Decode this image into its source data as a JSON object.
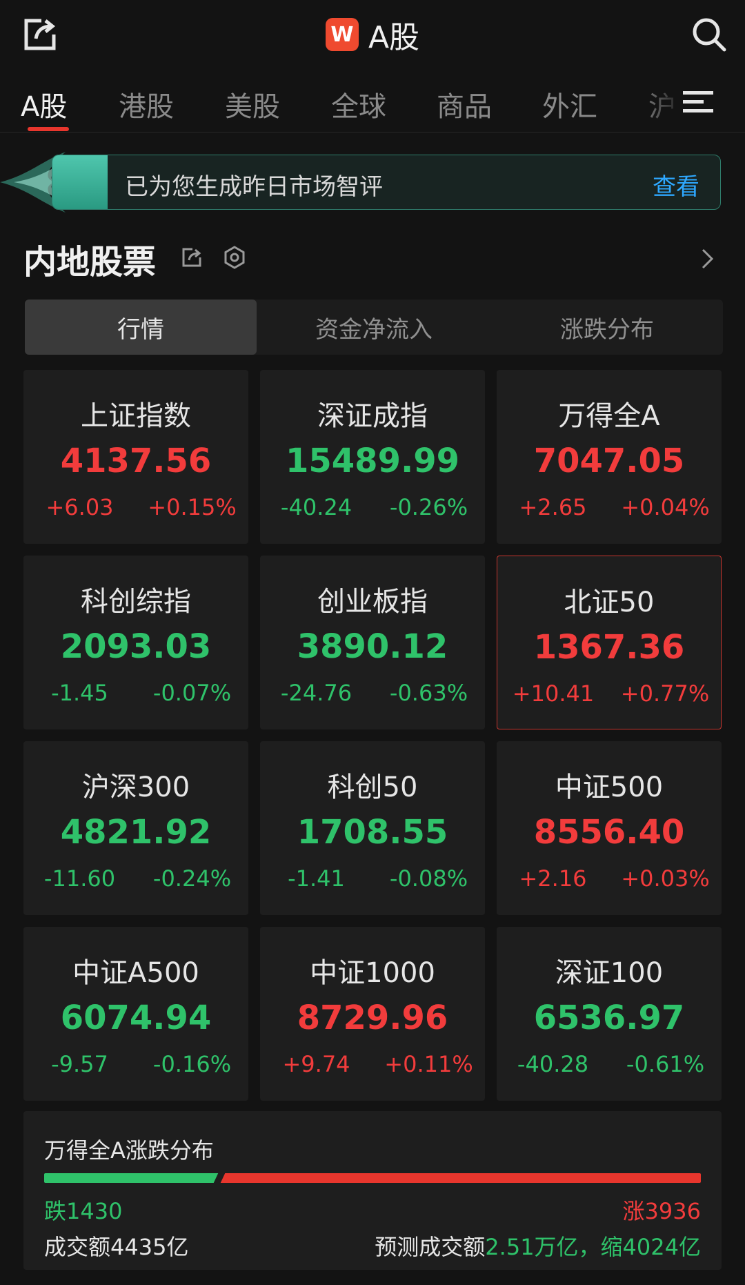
{
  "header": {
    "title": "A股",
    "logo_text": "W",
    "logo_color": "#ef4a2f"
  },
  "tabs": [
    {
      "label": "A股",
      "active": true
    },
    {
      "label": "港股",
      "active": false
    },
    {
      "label": "美股",
      "active": false
    },
    {
      "label": "全球",
      "active": false
    },
    {
      "label": "商品",
      "active": false
    },
    {
      "label": "外汇",
      "active": false
    },
    {
      "label": "沪",
      "active": false
    }
  ],
  "banner": {
    "text": "已为您生成昨日市场智评",
    "link": "查看"
  },
  "section": {
    "title": "内地股票"
  },
  "segments": [
    {
      "label": "行情",
      "active": true
    },
    {
      "label": "资金净流入",
      "active": false
    },
    {
      "label": "涨跌分布",
      "active": false
    }
  ],
  "indices": [
    {
      "name": "上证指数",
      "value": "4137.56",
      "change": "+6.03",
      "pct": "+0.15%",
      "dir": "up"
    },
    {
      "name": "深证成指",
      "value": "15489.99",
      "change": "-40.24",
      "pct": "-0.26%",
      "dir": "down"
    },
    {
      "name": "万得全A",
      "value": "7047.05",
      "change": "+2.65",
      "pct": "+0.04%",
      "dir": "up"
    },
    {
      "name": "科创综指",
      "value": "2093.03",
      "change": "-1.45",
      "pct": "-0.07%",
      "dir": "down"
    },
    {
      "name": "创业板指",
      "value": "3890.12",
      "change": "-24.76",
      "pct": "-0.63%",
      "dir": "down"
    },
    {
      "name": "北证50",
      "value": "1367.36",
      "change": "+10.41",
      "pct": "+0.77%",
      "dir": "up",
      "selected": true
    },
    {
      "name": "沪深300",
      "value": "4821.92",
      "change": "-11.60",
      "pct": "-0.24%",
      "dir": "down"
    },
    {
      "name": "科创50",
      "value": "1708.55",
      "change": "-1.41",
      "pct": "-0.08%",
      "dir": "down"
    },
    {
      "name": "中证500",
      "value": "8556.40",
      "change": "+2.16",
      "pct": "+0.03%",
      "dir": "up"
    },
    {
      "name": "中证A500",
      "value": "6074.94",
      "change": "-9.57",
      "pct": "-0.16%",
      "dir": "down"
    },
    {
      "name": "中证1000",
      "value": "8729.96",
      "change": "+9.74",
      "pct": "+0.11%",
      "dir": "up"
    },
    {
      "name": "深证100",
      "value": "6536.97",
      "change": "-40.28",
      "pct": "-0.61%",
      "dir": "down"
    }
  ],
  "breadth": {
    "title": "万得全A涨跌分布",
    "falls_label": "跌1430",
    "rises_label": "涨3936",
    "falls": 1430,
    "rises": 3936,
    "turnover": "成交额4435亿",
    "forecast_prefix": "预测成交额",
    "forecast_value": "2.51万亿，缩4024亿"
  },
  "colors": {
    "up": "#f23c3c",
    "down": "#2fc26a",
    "accent": "#e8362d",
    "link": "#2ea8ff",
    "banner_accent": "#4fc6ad"
  },
  "icons": [
    "share-icon",
    "search-icon",
    "menu-icon",
    "settings-icon",
    "chevron-right-icon"
  ]
}
